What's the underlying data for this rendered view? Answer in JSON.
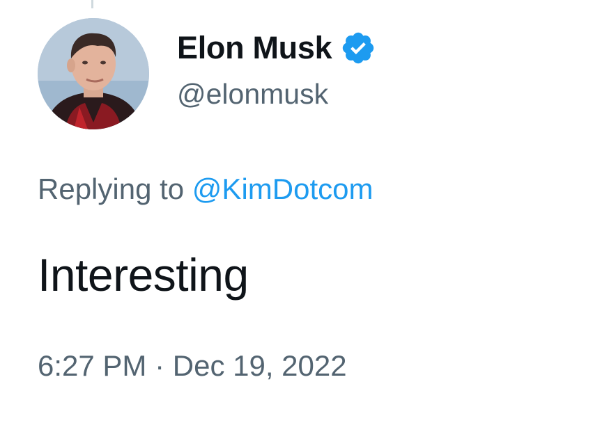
{
  "tweet": {
    "author": {
      "display_name": "Elon Musk",
      "handle": "@elonmusk",
      "verified_icon": "verified-badge-icon",
      "verified_color": "#1d9bf0"
    },
    "reply": {
      "prefix": "Replying to",
      "to_handle": "@KimDotcom"
    },
    "text": "Interesting",
    "time": "6:27 PM",
    "separator": "·",
    "date": "Dec 19, 2022"
  },
  "colors": {
    "primary_text": "#0f1419",
    "secondary_text": "#536471",
    "link": "#1d9bf0",
    "background": "#ffffff"
  }
}
